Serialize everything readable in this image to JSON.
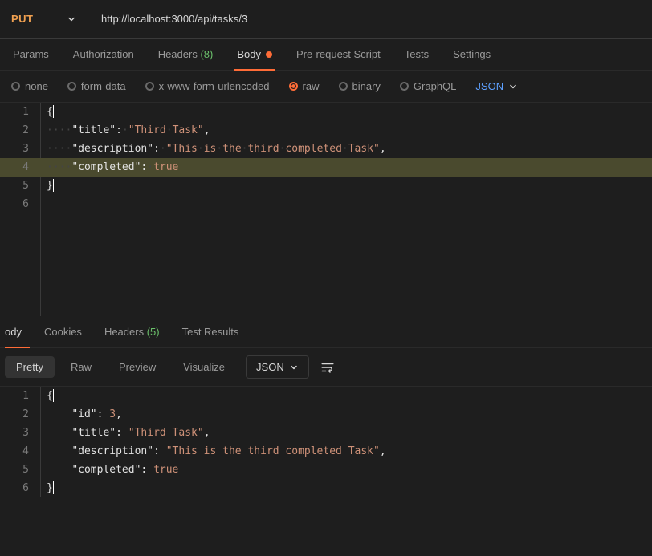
{
  "method": "PUT",
  "url": "http://localhost:3000/api/tasks/3",
  "tabs": [
    "Params",
    "Authorization",
    "Headers",
    "Body",
    "Pre-request Script",
    "Tests",
    "Settings"
  ],
  "active_tab": "Body",
  "headers_count": "(8)",
  "body_modified": true,
  "body_types": [
    "none",
    "form-data",
    "x-www-form-urlencoded",
    "raw",
    "binary",
    "GraphQL"
  ],
  "body_selected": "raw",
  "body_lang": "JSON",
  "request_body": {
    "lines": [
      {
        "n": 1,
        "html": "<span class='p'>{</span><span class='cursor'></span>"
      },
      {
        "n": 2,
        "html": "<span class='ws'>····</span><span class='k'>\"title\"</span><span class='p'>:</span><span class='ws'>·</span><span class='s'>\"Third<span class='ws'>·</span>Task\"</span><span class='p'>,</span>"
      },
      {
        "n": 3,
        "html": "<span class='ws'>····</span><span class='k'>\"description\"</span><span class='p'>:</span><span class='ws'>·</span><span class='s'>\"This<span class='ws'>·</span>is<span class='ws'>·</span>the<span class='ws'>·</span>third<span class='ws'>·</span>completed<span class='ws'>·</span>Task\"</span><span class='p'>,</span>"
      },
      {
        "n": 4,
        "hl": true,
        "html": "<span class='ws'>····</span><span class='k'>\"completed\"</span><span class='p'>:</span><span class='ws'>·</span><span class='b'>true</span>"
      },
      {
        "n": 5,
        "html": "<span class='p'>}</span><span class='cursor'></span>"
      },
      {
        "n": 6,
        "html": ""
      }
    ]
  },
  "response_tabs": [
    "ody",
    "Cookies",
    "Headers",
    "Test Results"
  ],
  "response_active": "ody",
  "response_headers_count": "(5)",
  "response_views": [
    "Pretty",
    "Raw",
    "Preview",
    "Visualize"
  ],
  "response_view_selected": "Pretty",
  "response_lang": "JSON",
  "response_body": {
    "lines": [
      {
        "n": 1,
        "html": "<span class='p'>{</span><span class='cursor'></span>"
      },
      {
        "n": 2,
        "html": "    <span class='k'>\"id\"</span><span class='p'>:</span> <span class='b'>3</span><span class='p'>,</span>"
      },
      {
        "n": 3,
        "html": "    <span class='k'>\"title\"</span><span class='p'>:</span> <span class='s'>\"Third Task\"</span><span class='p'>,</span>"
      },
      {
        "n": 4,
        "html": "    <span class='k'>\"description\"</span><span class='p'>:</span> <span class='s'>\"This is the third completed Task\"</span><span class='p'>,</span>"
      },
      {
        "n": 5,
        "html": "    <span class='k'>\"completed\"</span><span class='p'>:</span> <span class='b'>true</span>"
      },
      {
        "n": 6,
        "html": "<span class='p'>}</span><span class='cursor'></span>"
      }
    ]
  }
}
